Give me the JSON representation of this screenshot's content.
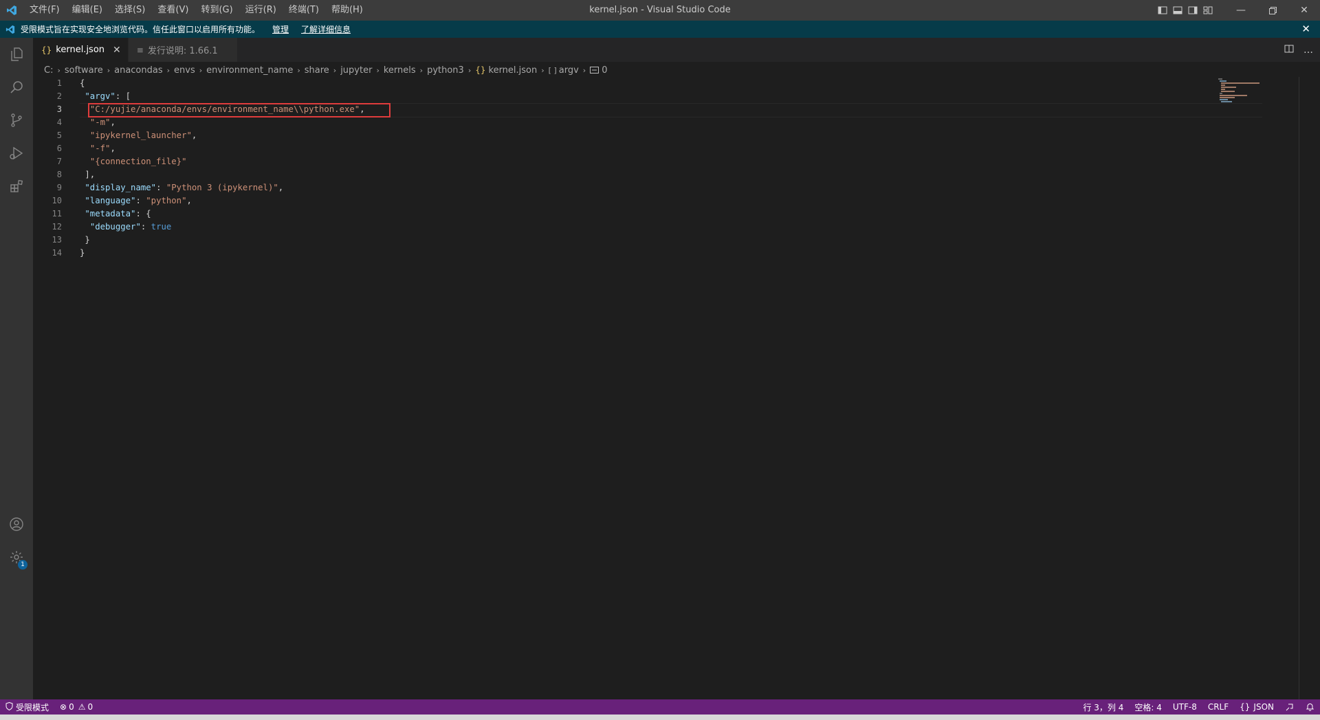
{
  "window": {
    "title": "kernel.json - Visual Studio Code",
    "menu": [
      "文件(F)",
      "编辑(E)",
      "选择(S)",
      "查看(V)",
      "转到(G)",
      "运行(R)",
      "终端(T)",
      "帮助(H)"
    ]
  },
  "banner": {
    "message": "受限模式旨在实现安全地浏览代码。信任此窗口以启用所有功能。",
    "manage_link": "管理",
    "learn_more_link": "了解详细信息"
  },
  "tabs": [
    {
      "icon": "{}",
      "label": "kernel.json",
      "active": true
    },
    {
      "icon": "≡",
      "label": "发行说明: 1.66.1",
      "active": false
    }
  ],
  "breadcrumb": {
    "parts": [
      "C:",
      "software",
      "anacondas",
      "envs",
      "environment_name",
      "share",
      "jupyter",
      "kernels",
      "python3"
    ],
    "file": "kernel.json",
    "symbol_array": "argv",
    "symbol_index": "0"
  },
  "editor": {
    "line_numbers": [
      "1",
      "2",
      "3",
      "4",
      "5",
      "6",
      "7",
      "8",
      "9",
      "10",
      "11",
      "12",
      "13",
      "14"
    ],
    "current_line": 3,
    "lines": [
      [
        {
          "t": "p",
          "v": "{"
        }
      ],
      [
        {
          "t": "p",
          "v": " "
        },
        {
          "t": "k",
          "v": "\"argv\""
        },
        {
          "t": "p",
          "v": ": ["
        }
      ],
      [
        {
          "t": "p",
          "v": "  "
        },
        {
          "t": "s",
          "v": "\"C:/yujie/anaconda/envs/environment_name\\\\python.exe\""
        },
        {
          "t": "p",
          "v": ","
        }
      ],
      [
        {
          "t": "p",
          "v": "  "
        },
        {
          "t": "s",
          "v": "\"-m\""
        },
        {
          "t": "p",
          "v": ","
        }
      ],
      [
        {
          "t": "p",
          "v": "  "
        },
        {
          "t": "s",
          "v": "\"ipykernel_launcher\""
        },
        {
          "t": "p",
          "v": ","
        }
      ],
      [
        {
          "t": "p",
          "v": "  "
        },
        {
          "t": "s",
          "v": "\"-f\""
        },
        {
          "t": "p",
          "v": ","
        }
      ],
      [
        {
          "t": "p",
          "v": "  "
        },
        {
          "t": "s",
          "v": "\"{connection_file}\""
        }
      ],
      [
        {
          "t": "p",
          "v": " ],"
        }
      ],
      [
        {
          "t": "p",
          "v": " "
        },
        {
          "t": "k",
          "v": "\"display_name\""
        },
        {
          "t": "p",
          "v": ": "
        },
        {
          "t": "s",
          "v": "\"Python 3 (ipykernel)\""
        },
        {
          "t": "p",
          "v": ","
        }
      ],
      [
        {
          "t": "p",
          "v": " "
        },
        {
          "t": "k",
          "v": "\"language\""
        },
        {
          "t": "p",
          "v": ": "
        },
        {
          "t": "s",
          "v": "\"python\""
        },
        {
          "t": "p",
          "v": ","
        }
      ],
      [
        {
          "t": "p",
          "v": " "
        },
        {
          "t": "k",
          "v": "\"metadata\""
        },
        {
          "t": "p",
          "v": ": {"
        }
      ],
      [
        {
          "t": "p",
          "v": "  "
        },
        {
          "t": "k",
          "v": "\"debugger\""
        },
        {
          "t": "p",
          "v": ": "
        },
        {
          "t": "b",
          "v": "true"
        }
      ],
      [
        {
          "t": "p",
          "v": " }"
        }
      ],
      [
        {
          "t": "p",
          "v": "}"
        }
      ]
    ]
  },
  "status": {
    "mode": "受限模式",
    "errors": "0",
    "warnings": "0",
    "position": "行 3，列 4",
    "indent": "空格: 4",
    "encoding": "UTF-8",
    "eol": "CRLF",
    "language": "JSON",
    "language_icon": "{}"
  },
  "activity": {
    "accounts_badge": "1"
  }
}
